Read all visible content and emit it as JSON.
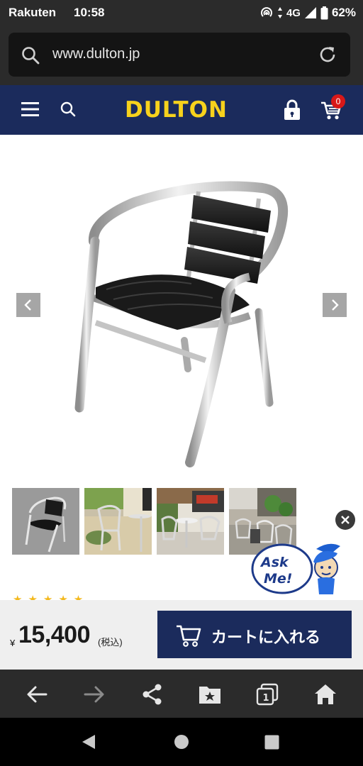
{
  "status_bar": {
    "carrier": "Rakuten",
    "time": "10:58",
    "network": "4G",
    "battery": "62%"
  },
  "browser": {
    "url": "www.dulton.jp"
  },
  "header": {
    "logo": "DULTON",
    "cart_count": "0",
    "brand_color": "#1b2b5c",
    "logo_color": "#f7d21c"
  },
  "gallery": {
    "main_image": "aluminium-chair-black-slats",
    "thumbnails": [
      "chair-grey-background",
      "chairs-outdoor-cafe",
      "chairs-storefront",
      "chairs-garden-terrace"
    ]
  },
  "rating": {
    "stars": "★★★★★"
  },
  "purchase": {
    "currency": "¥",
    "price": "15,400",
    "tax_note": "(税込)",
    "add_to_cart_label": "カートに入れる",
    "accent_color": "#1b2b5c"
  },
  "icons": {
    "toolbar": [
      "back-icon",
      "forward-icon",
      "share-icon",
      "bookmark-icon",
      "tabs-icon",
      "home-icon"
    ],
    "android": [
      "android-back-icon",
      "android-home-icon",
      "android-recents-icon"
    ]
  }
}
